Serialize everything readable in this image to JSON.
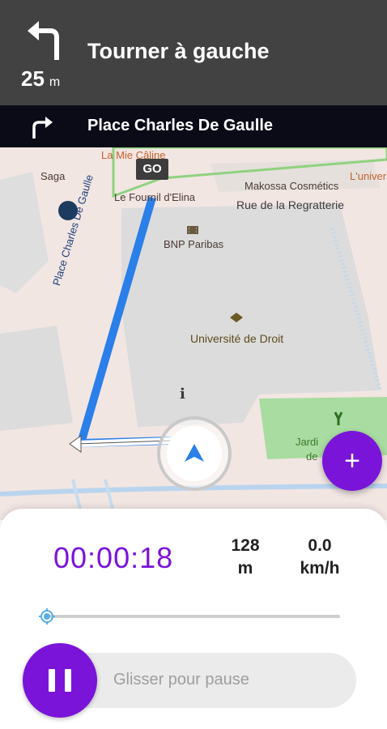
{
  "instruction": {
    "icon": "turn-left-arrow-icon",
    "distance_value": "25",
    "distance_unit": "m",
    "text": "Tourner à gauche"
  },
  "next": {
    "icon": "turn-right-arrow-icon",
    "street": "Place Charles De Gaulle"
  },
  "map": {
    "go_flag": "GO",
    "route_label": "Place Charles De Gaulle",
    "pois": {
      "la_mie_caline": "La Mie Câline",
      "saga": "Saga",
      "le_fournil": "Le Fournil d'Elina",
      "makossa": "Makossa Cosmétics",
      "lunivers": "L'univers",
      "street_regratterie": "Rue de la Regratterie",
      "bnp": "BNP Paribas",
      "universite": "Université de Droit",
      "jardin_1": "Jardi",
      "jardin_2": "de"
    },
    "route_color": "#2a7fe8",
    "park_color": "#a8dca0"
  },
  "add_button": "+",
  "stats": {
    "timer": "00:00:18",
    "distance_value": "128",
    "distance_unit": "m",
    "speed_value": "0.0",
    "speed_unit": "km/h"
  },
  "progress": {
    "fraction": 0.0
  },
  "pause": {
    "label": "Glisser pour pause"
  },
  "colors": {
    "accent": "#7b14d9",
    "header_bg": "#424242",
    "next_bar_bg": "#0b0b18"
  }
}
